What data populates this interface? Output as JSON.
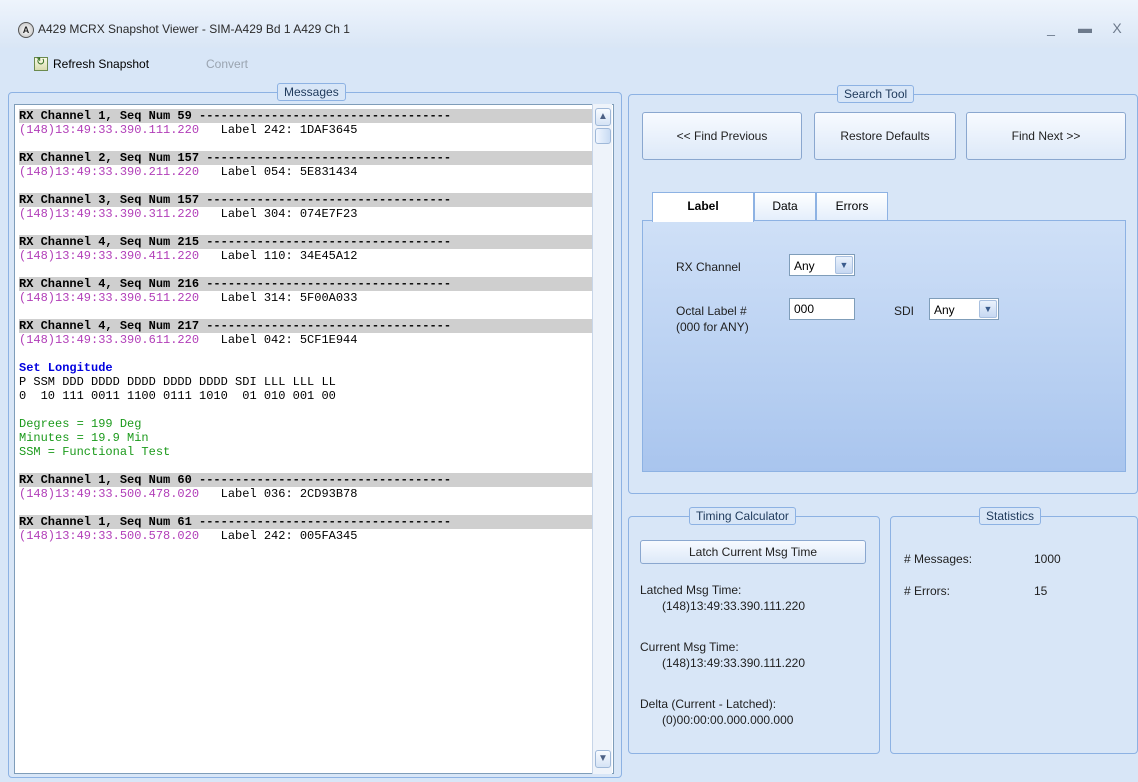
{
  "window": {
    "app_icon": "A",
    "title": "A429 MCRX Snapshot Viewer - SIM-A429 Bd 1 A429 Ch 1",
    "minimize_glyph": "_",
    "maximize_glyph": "▬",
    "close_glyph": "X"
  },
  "toolbar": {
    "refresh_label": "Refresh Snapshot",
    "convert_label": "Convert"
  },
  "messages": {
    "title": "Messages",
    "scroll_up": "▲",
    "scroll_down": "▼",
    "lines": [
      {
        "style": "hdr",
        "text": "RX Channel 1, Seq Num 59 -----------------------------------"
      },
      {
        "style": "ts",
        "text": "(148)13:49:33.390.111.220",
        "label": "   Label 242: 1DAF3645"
      },
      {
        "style": "blank",
        "text": ""
      },
      {
        "style": "hdr",
        "text": "RX Channel 2, Seq Num 157 ----------------------------------"
      },
      {
        "style": "ts",
        "text": "(148)13:49:33.390.211.220",
        "label": "   Label 054: 5E831434"
      },
      {
        "style": "blank",
        "text": ""
      },
      {
        "style": "hdr",
        "text": "RX Channel 3, Seq Num 157 ----------------------------------"
      },
      {
        "style": "ts",
        "text": "(148)13:49:33.390.311.220",
        "label": "   Label 304: 074E7F23"
      },
      {
        "style": "blank",
        "text": ""
      },
      {
        "style": "hdr",
        "text": "RX Channel 4, Seq Num 215 ----------------------------------"
      },
      {
        "style": "ts",
        "text": "(148)13:49:33.390.411.220",
        "label": "   Label 110: 34E45A12"
      },
      {
        "style": "blank",
        "text": ""
      },
      {
        "style": "hdr",
        "text": "RX Channel 4, Seq Num 216 ----------------------------------"
      },
      {
        "style": "ts",
        "text": "(148)13:49:33.390.511.220",
        "label": "   Label 314: 5F00A033"
      },
      {
        "style": "blank",
        "text": ""
      },
      {
        "style": "hdr",
        "text": "RX Channel 4, Seq Num 217 ----------------------------------"
      },
      {
        "style": "ts",
        "text": "(148)13:49:33.390.611.220",
        "label": "   Label 042: 5CF1E944"
      },
      {
        "style": "blank",
        "text": ""
      },
      {
        "style": "blue",
        "text": "Set Longitude"
      },
      {
        "style": "plain",
        "text": "P SSM DDD DDDD DDDD DDDD DDDD SDI LLL LLL LL"
      },
      {
        "style": "plain",
        "text": "0  10 111 0011 1100 0111 1010  01 010 001 00"
      },
      {
        "style": "blank",
        "text": ""
      },
      {
        "style": "green",
        "text": "Degrees = 199 Deg"
      },
      {
        "style": "green",
        "text": "Minutes = 19.9 Min"
      },
      {
        "style": "green",
        "text": "SSM = Functional Test"
      },
      {
        "style": "blank",
        "text": ""
      },
      {
        "style": "hdr",
        "text": "RX Channel 1, Seq Num 60 -----------------------------------"
      },
      {
        "style": "ts",
        "text": "(148)13:49:33.500.478.020",
        "label": "   Label 036: 2CD93B78"
      },
      {
        "style": "blank",
        "text": ""
      },
      {
        "style": "hdr",
        "text": "RX Channel 1, Seq Num 61 -----------------------------------"
      },
      {
        "style": "ts",
        "text": "(148)13:49:33.500.578.020",
        "label": "   Label 242: 005FA345"
      }
    ]
  },
  "search": {
    "title": "Search Tool",
    "find_previous": "<< Find Previous",
    "restore_defaults": "Restore Defaults",
    "find_next": "Find Next >>",
    "tabs": [
      "Label",
      "Data",
      "Errors"
    ],
    "rx_channel_label": "RX Channel",
    "rx_channel_value": "Any",
    "octal_label": "Octal Label #",
    "octal_hint": "(000 for ANY)",
    "octal_value": "000",
    "sdi_label": "SDI",
    "sdi_value": "Any",
    "dropdown_glyph": "▼"
  },
  "timing": {
    "title": "Timing Calculator",
    "latch_button": "Latch Current Msg Time",
    "latched_label": "Latched Msg Time:",
    "latched_value": "(148)13:49:33.390.111.220",
    "current_label": "Current Msg Time:",
    "current_value": "(148)13:49:33.390.111.220",
    "delta_label": "Delta (Current - Latched):",
    "delta_value": "(0)00:00:00.000.000.000"
  },
  "statistics": {
    "title": "Statistics",
    "messages_label": "# Messages:",
    "messages_value": "1000",
    "errors_label": "# Errors:",
    "errors_value": "15"
  }
}
